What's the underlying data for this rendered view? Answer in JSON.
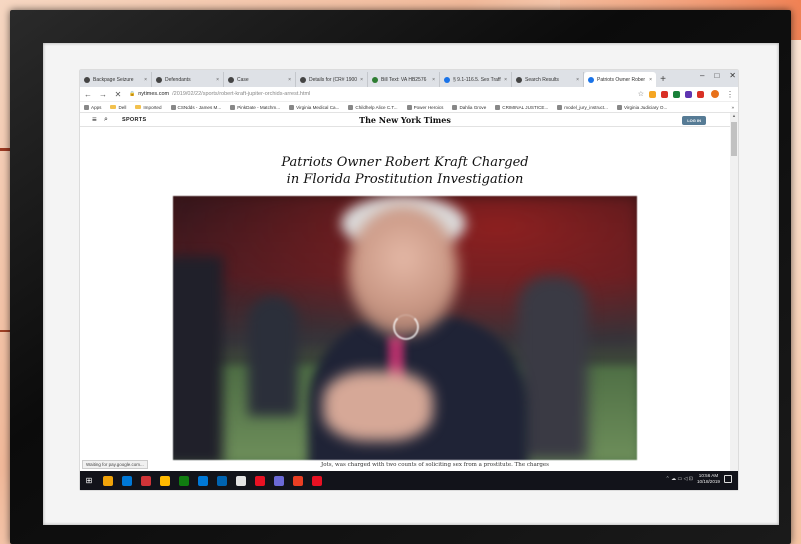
{
  "browser": {
    "tabs": [
      {
        "label": "Backpage Seizure",
        "favicon_color": "#444444",
        "active": false
      },
      {
        "label": "Defendants",
        "favicon_color": "#444444",
        "active": false
      },
      {
        "label": "Case",
        "favicon_color": "#444444",
        "active": false
      },
      {
        "label": "Details for (CR# 1900",
        "favicon_color": "#444444",
        "active": false
      },
      {
        "label": "Bill Text: VA HB2576",
        "favicon_color": "#2e7d32",
        "active": false
      },
      {
        "label": "§ 9.1-116.5. Sex Traffi",
        "favicon_color": "#1a73e8",
        "active": false
      },
      {
        "label": "Search Results",
        "favicon_color": "#444444",
        "active": false
      },
      {
        "label": "Patriots Owner Rober",
        "favicon_color": "#1a73e8",
        "active": true
      }
    ],
    "new_tab_glyph": "+",
    "window_controls": {
      "minimize": "–",
      "maximize": "□",
      "close": "✕"
    },
    "nav": {
      "back": "←",
      "forward": "→",
      "stop": "✕"
    },
    "url_host": "nytimes.com",
    "url_path": "/2019/02/22/sports/robert-kraft-jupiter-orchids-arrest.html",
    "star": "☆",
    "profile_initial": "",
    "extension_colors": [
      "#f5a623",
      "#d93025",
      "#188038",
      "#5e35b1",
      "#d93025"
    ],
    "bookmarks": [
      {
        "label": "Apps",
        "icon": "apps-icon"
      },
      {
        "label": "Dell",
        "icon": "folder-icon"
      },
      {
        "label": "Imported",
        "icon": "folder-icon"
      },
      {
        "label": "CSNdds - James M...",
        "icon": "page-icon"
      },
      {
        "label": "PinkDate - Matchm...",
        "icon": "page-icon"
      },
      {
        "label": "Virginia Medical Ca...",
        "icon": "page-icon"
      },
      {
        "label": "Childhelp Alice C.T...",
        "icon": "page-icon"
      },
      {
        "label": "Power Heroics",
        "icon": "page-icon"
      },
      {
        "label": "Dahlia Grove",
        "icon": "page-icon"
      },
      {
        "label": "CRIMINAL JUSTICE...",
        "icon": "page-icon"
      },
      {
        "label": "model_jury_instruct...",
        "icon": "page-icon"
      },
      {
        "label": "Virginia Judiciary O...",
        "icon": "page-icon"
      }
    ],
    "bookmarks_overflow": "»"
  },
  "nyt": {
    "section": "SPORTS",
    "masthead": "The New York Times",
    "login": "LOG IN"
  },
  "article": {
    "headline_line1": "Patriots Owner Robert Kraft Charged",
    "headline_line2": "in Florida Prostitution Investigation",
    "body_snippet": "Jots, was charged with two counts of soliciting sex from a prostitute. The charges"
  },
  "status_bar": "Waiting for pay.google.com...",
  "taskbar": {
    "start_glyph": "⊞",
    "app_colors": [
      "#f0a30a",
      "#0078d7",
      "#d13438",
      "#ffb900",
      "#107c10",
      "#0078d7",
      "#0063b1",
      "#e3e3e3",
      "#e81123",
      "#6b69d6",
      "#ea3e23",
      "#e81123"
    ],
    "clock_time": "10:56 AM",
    "clock_date": "10/18/2019",
    "tray": "⌃ ☁ ▭ ◁ ⊡"
  }
}
